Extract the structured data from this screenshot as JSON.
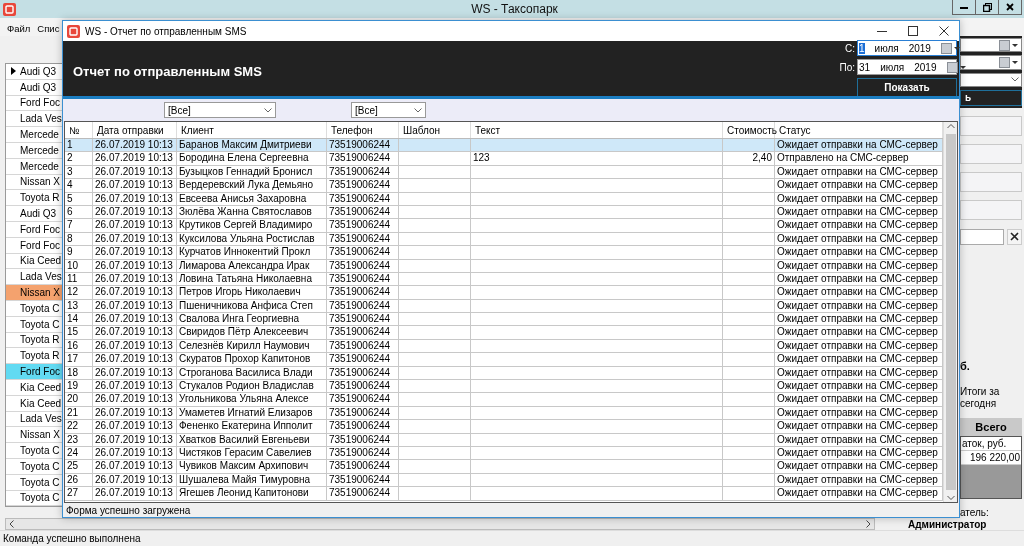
{
  "main_window": {
    "title": "WS - Таксопарк",
    "menu": [
      "Файл",
      "Спис"
    ],
    "vehicles": [
      {
        "label": "Audi Q3",
        "current": true,
        "color": "#ffffff"
      },
      {
        "label": "Audi Q3",
        "current": false,
        "color": "#ffffff"
      },
      {
        "label": "Ford Foc",
        "current": false,
        "color": "#ffffff"
      },
      {
        "label": "Lada Ves",
        "current": false,
        "color": "#ffffff"
      },
      {
        "label": "Mercede",
        "current": false,
        "color": "#ffffff"
      },
      {
        "label": "Mercede",
        "current": false,
        "color": "#ffffff"
      },
      {
        "label": "Mercede",
        "current": false,
        "color": "#ffffff"
      },
      {
        "label": "Nissan X",
        "current": false,
        "color": "#ffffff"
      },
      {
        "label": "Toyota R",
        "current": false,
        "color": "#ffffff"
      },
      {
        "label": "Audi Q3",
        "current": false,
        "color": "#ffffff"
      },
      {
        "label": "Ford Foc",
        "current": false,
        "color": "#ffffff"
      },
      {
        "label": "Ford Foc",
        "current": false,
        "color": "#ffffff"
      },
      {
        "label": "Kia Ceed",
        "current": false,
        "color": "#ffffff"
      },
      {
        "label": "Lada Ves",
        "current": false,
        "color": "#ffffff"
      },
      {
        "label": "Nissan X",
        "current": false,
        "color": "#f4a26e"
      },
      {
        "label": "Toyota C",
        "current": false,
        "color": "#ffffff"
      },
      {
        "label": "Toyota C",
        "current": false,
        "color": "#ffffff"
      },
      {
        "label": "Toyota R",
        "current": false,
        "color": "#ffffff"
      },
      {
        "label": "Toyota R",
        "current": false,
        "color": "#ffffff"
      },
      {
        "label": "Ford Foc",
        "current": false,
        "color": "#62daf2"
      },
      {
        "label": "Kia Ceed",
        "current": false,
        "color": "#ffffff"
      },
      {
        "label": "Kia Ceed",
        "current": false,
        "color": "#ffffff"
      },
      {
        "label": "Lada Ves",
        "current": false,
        "color": "#ffffff"
      },
      {
        "label": "Nissan X",
        "current": false,
        "color": "#ffffff"
      },
      {
        "label": "Toyota C",
        "current": false,
        "color": "#ffffff"
      },
      {
        "label": "Toyota C",
        "current": false,
        "color": "#ffffff"
      },
      {
        "label": "Toyota C",
        "current": false,
        "color": "#ffffff"
      },
      {
        "label": "Toyota C",
        "current": false,
        "color": "#ffffff"
      }
    ],
    "side_panel": {
      "button_fragment": "ь",
      "label_fragment": "б.",
      "totals_caption": "Итоги за сегодня",
      "totals_column": "Всего",
      "totals_row_label": "аток, руб.",
      "totals_value": "196 220,00",
      "user_caption": "атель:",
      "user_name": "Администратор"
    },
    "status_bar": "Команда успешно выполнена"
  },
  "dialog": {
    "title": "WS - Отчет по отправленным SMS",
    "heading": "Отчет по отправленным SMS",
    "date_from": {
      "label": "С:",
      "day": "1",
      "month": "июля",
      "year": "2019",
      "day_highlighted": true
    },
    "date_to": {
      "label": "По:",
      "day": "31",
      "month": "июля",
      "year": "2019",
      "day_highlighted": false
    },
    "show_button": "Показать",
    "filters": [
      {
        "value": "[Все]"
      },
      {
        "value": "[Все]"
      }
    ],
    "table": {
      "columns": [
        "№",
        "Дата отправки",
        "Клиент",
        "Телефон",
        "Шаблон",
        "Текст",
        "Стоимость",
        "Статус"
      ],
      "rows": [
        {
          "n": "1",
          "date": "26.07.2019 10:13",
          "client": "Баранов Максим Дмитриеви",
          "phone": "73519006244",
          "status": "Ожидает отправки на СМС-сервер",
          "selected": true
        },
        {
          "n": "2",
          "date": "26.07.2019 10:13",
          "client": "Бородина Елена Сергеевна",
          "phone": "73519006244",
          "text": "123",
          "cost": "2,40",
          "status": "Отправлено на СМС-сервер",
          "selected": false
        },
        {
          "n": "3",
          "date": "26.07.2019 10:13",
          "client": "Бузыцков Геннадий Бронисл",
          "phone": "73519006244",
          "status": "Ожидает отправки на СМС-сервер",
          "selected": false
        },
        {
          "n": "4",
          "date": "26.07.2019 10:13",
          "client": "Вердеревский Лука Демьяно",
          "phone": "73519006244",
          "status": "Ожидает отправки на СМС-сервер",
          "selected": false
        },
        {
          "n": "5",
          "date": "26.07.2019 10:13",
          "client": "Евсеева Анисья Захаровна",
          "phone": "73519006244",
          "status": "Ожидает отправки на СМС-сервер",
          "selected": false
        },
        {
          "n": "6",
          "date": "26.07.2019 10:13",
          "client": "Зюлёва Жанна Святославов",
          "phone": "73519006244",
          "status": "Ожидает отправки на СМС-сервер",
          "selected": false
        },
        {
          "n": "7",
          "date": "26.07.2019 10:13",
          "client": "Крутиков Сергей Владимиро",
          "phone": "73519006244",
          "status": "Ожидает отправки на СМС-сервер",
          "selected": false
        },
        {
          "n": "8",
          "date": "26.07.2019 10:13",
          "client": "Куксилова Ульяна Ростислав",
          "phone": "73519006244",
          "status": "Ожидает отправки на СМС-сервер",
          "selected": false
        },
        {
          "n": "9",
          "date": "26.07.2019 10:13",
          "client": "Курчатов Иннокентий Прокл",
          "phone": "73519006244",
          "status": "Ожидает отправки на СМС-сервер",
          "selected": false
        },
        {
          "n": "10",
          "date": "26.07.2019 10:13",
          "client": "Лимарова Александра Ирак",
          "phone": "73519006244",
          "status": "Ожидает отправки на СМС-сервер",
          "selected": false
        },
        {
          "n": "11",
          "date": "26.07.2019 10:13",
          "client": "Ловина Татьяна Николаевна",
          "phone": "73519006244",
          "status": "Ожидает отправки на СМС-сервер",
          "selected": false
        },
        {
          "n": "12",
          "date": "26.07.2019 10:13",
          "client": "Петров Игорь Николаевич",
          "phone": "73519006244",
          "status": "Ожидает отправки на СМС-сервер",
          "selected": false
        },
        {
          "n": "13",
          "date": "26.07.2019 10:13",
          "client": "Пшеничникова Анфиса Степ",
          "phone": "73519006244",
          "status": "Ожидает отправки на СМС-сервер",
          "selected": false
        },
        {
          "n": "14",
          "date": "26.07.2019 10:13",
          "client": "Свалова Инга Георгиевна",
          "phone": "73519006244",
          "status": "Ожидает отправки на СМС-сервер",
          "selected": false
        },
        {
          "n": "15",
          "date": "26.07.2019 10:13",
          "client": "Свиридов Пётр Алексеевич",
          "phone": "73519006244",
          "status": "Ожидает отправки на СМС-сервер",
          "selected": false
        },
        {
          "n": "16",
          "date": "26.07.2019 10:13",
          "client": "Селезнёв Кирилл Наумович",
          "phone": "73519006244",
          "status": "Ожидает отправки на СМС-сервер",
          "selected": false
        },
        {
          "n": "17",
          "date": "26.07.2019 10:13",
          "client": "Скуратов Прохор Капитонов",
          "phone": "73519006244",
          "status": "Ожидает отправки на СМС-сервер",
          "selected": false
        },
        {
          "n": "18",
          "date": "26.07.2019 10:13",
          "client": "Строганова Василиса Влади",
          "phone": "73519006244",
          "status": "Ожидает отправки на СМС-сервер",
          "selected": false
        },
        {
          "n": "19",
          "date": "26.07.2019 10:13",
          "client": "Стукалов Родион Владислав",
          "phone": "73519006244",
          "status": "Ожидает отправки на СМС-сервер",
          "selected": false
        },
        {
          "n": "20",
          "date": "26.07.2019 10:13",
          "client": "Угольникова Ульяна Алексе",
          "phone": "73519006244",
          "status": "Ожидает отправки на СМС-сервер",
          "selected": false
        },
        {
          "n": "21",
          "date": "26.07.2019 10:13",
          "client": "Умаметев Игнатий Елизаров",
          "phone": "73519006244",
          "status": "Ожидает отправки на СМС-сервер",
          "selected": false
        },
        {
          "n": "22",
          "date": "26.07.2019 10:13",
          "client": "Фененко Екатерина Ипполит",
          "phone": "73519006244",
          "status": "Ожидает отправки на СМС-сервер",
          "selected": false
        },
        {
          "n": "23",
          "date": "26.07.2019 10:13",
          "client": "Хватков Василий Евгеньеви",
          "phone": "73519006244",
          "status": "Ожидает отправки на СМС-сервер",
          "selected": false
        },
        {
          "n": "24",
          "date": "26.07.2019 10:13",
          "client": "Чистяков Герасим Савелиев",
          "phone": "73519006244",
          "status": "Ожидает отправки на СМС-сервер",
          "selected": false
        },
        {
          "n": "25",
          "date": "26.07.2019 10:13",
          "client": "Чувиков Максим Архипович",
          "phone": "73519006244",
          "status": "Ожидает отправки на СМС-сервер",
          "selected": false
        },
        {
          "n": "26",
          "date": "26.07.2019 10:13",
          "client": "Шушалева Майя Тимуровна",
          "phone": "73519006244",
          "status": "Ожидает отправки на СМС-сервер",
          "selected": false
        },
        {
          "n": "27",
          "date": "26.07.2019 10:13",
          "client": "Ягешев Леонид Капитонови",
          "phone": "73519006244",
          "status": "Ожидает отправки на СМС-сервер",
          "selected": false
        }
      ]
    },
    "status_bar": "Форма успешно загружена"
  }
}
